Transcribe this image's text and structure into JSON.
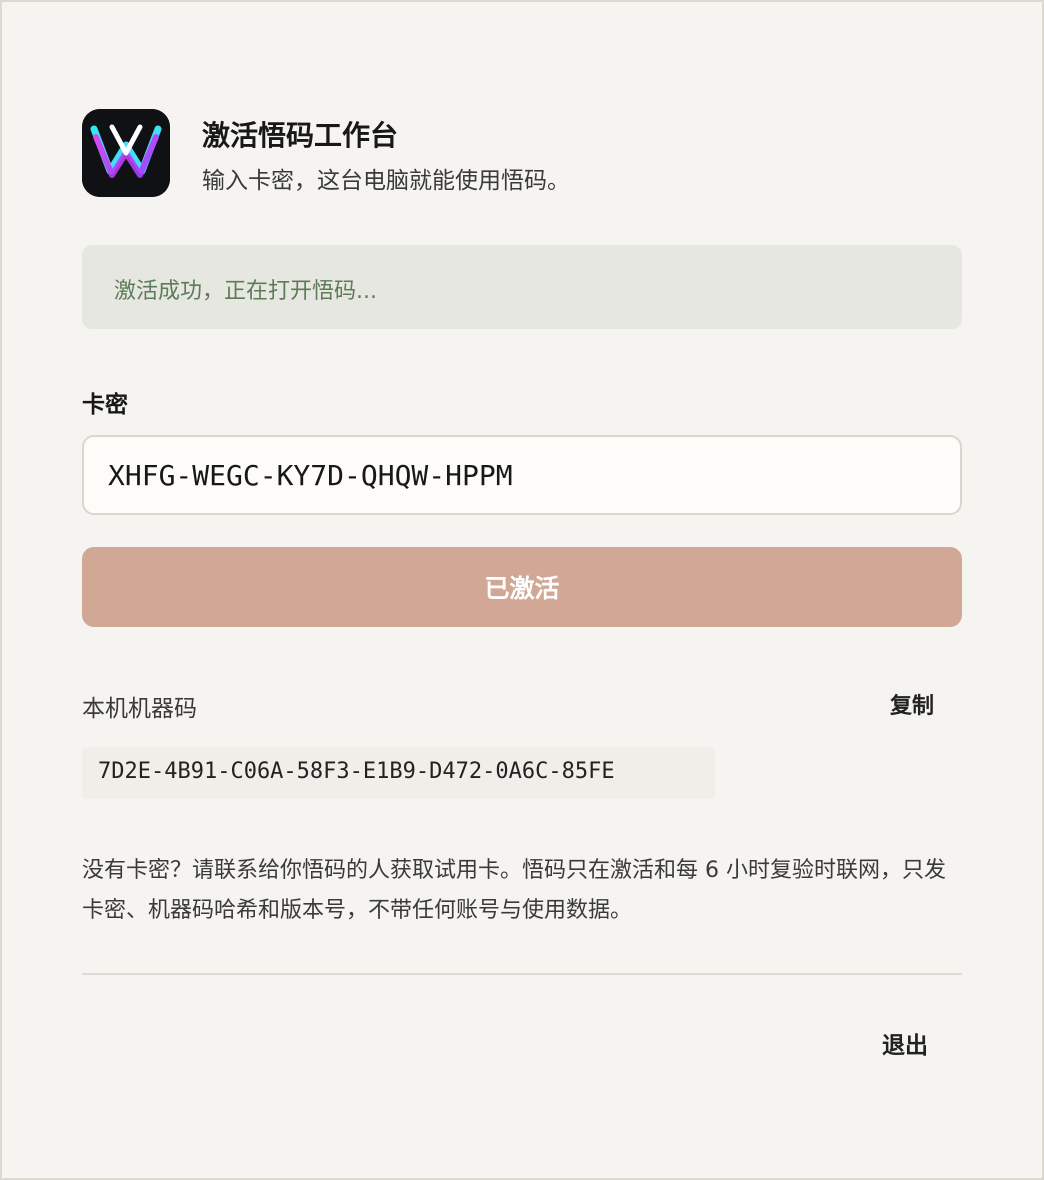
{
  "header": {
    "app_icon": "wuma-logo-icon",
    "title": "激活悟码工作台",
    "subtitle": "输入卡密，这台电脑就能使用悟码。"
  },
  "status": {
    "message": "激活成功，正在打开悟码..."
  },
  "key_field": {
    "label": "卡密",
    "value": "XHFG-WEGC-KY7D-QHQW-HPPM"
  },
  "activate_button": {
    "label": "已激活"
  },
  "machine": {
    "label": "本机机器码",
    "copy_label": "复制",
    "code": "7D2E-4B91-C06A-58F3-E1B9-D472-0A6C-85FE"
  },
  "help": {
    "text": "没有卡密？请联系给你悟码的人获取试用卡。悟码只在激活和每 6 小时复验时联网，只发卡密、机器码哈希和版本号，不带任何账号与使用数据。"
  },
  "footer": {
    "logout_label": "退出"
  },
  "colors": {
    "background": "#f6f4f0",
    "status_bg": "#e7e7e1",
    "status_text": "#5c7c57",
    "button_bg": "#d1a796",
    "input_bg": "#fdfcf9"
  }
}
